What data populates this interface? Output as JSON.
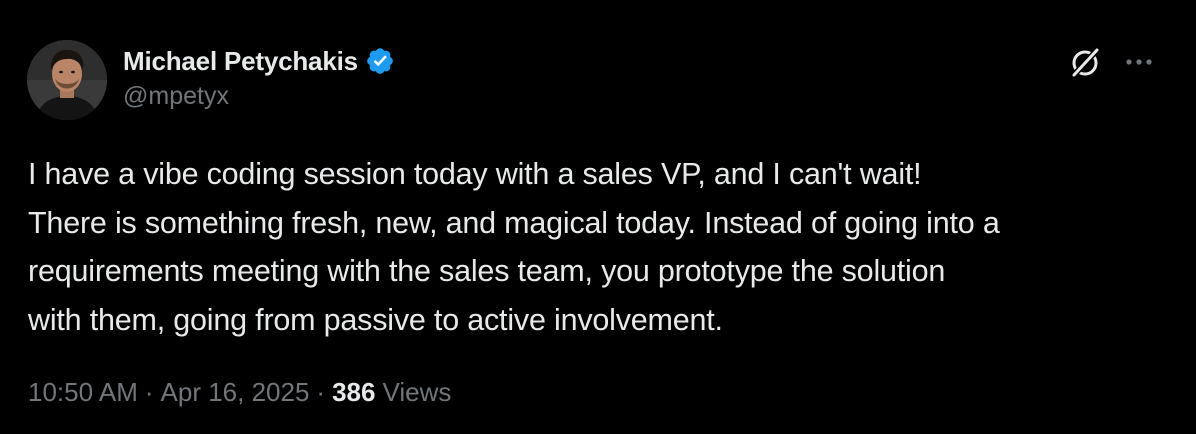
{
  "author": {
    "display_name": "Michael Petychakis",
    "handle": "@mpetyx",
    "verified": true
  },
  "icons": {
    "avatar": "profile-photo",
    "verified": "verified-badge-icon",
    "grok": "grok-icon",
    "more": "more-horizontal-icon"
  },
  "tweet": {
    "text": "I have a vibe coding session today with a sales VP, and I can't wait!\nThere is something fresh, new, and magical today. Instead of going into a\nrequirements meeting with the sales team, you prototype the solution\nwith them, going from passive to active involvement."
  },
  "meta": {
    "time": "10:50 AM",
    "separator": "·",
    "date": "Apr 16, 2025",
    "views_count": "386",
    "views_label": "Views"
  },
  "colors": {
    "background": "#000000",
    "primary_text": "#e7e9ea",
    "secondary_text": "#71767b",
    "verified_blue": "#1d9bf0"
  }
}
